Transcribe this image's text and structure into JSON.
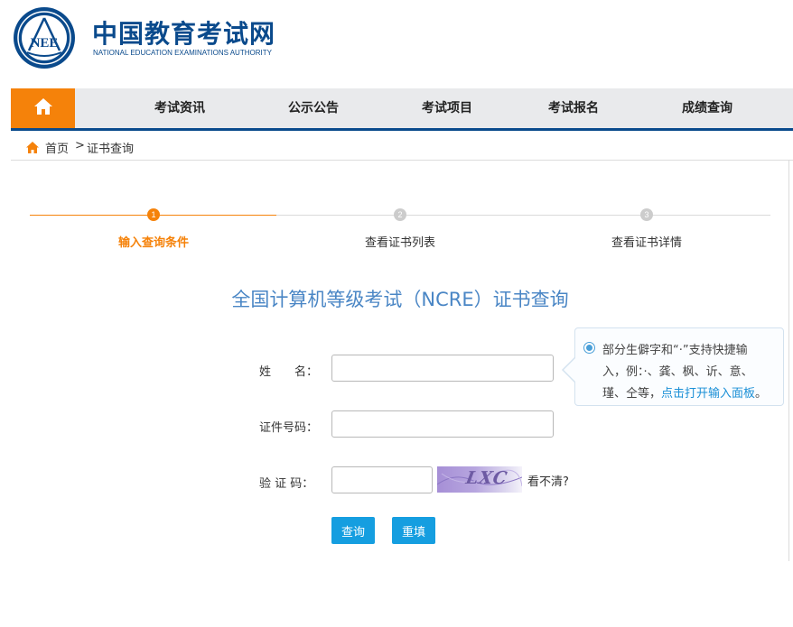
{
  "header": {
    "logo_text": "NEE",
    "site_name": "中国教育考试网",
    "site_name_en": "NATIONAL EDUCATION EXAMINATIONS AUTHORITY"
  },
  "nav": {
    "home_icon": "home-icon",
    "items": [
      "考试资讯",
      "公示公告",
      "考试项目",
      "考试报名",
      "成绩查询"
    ]
  },
  "breadcrumb": {
    "home": "首页",
    "separator": ">",
    "current": "证书查询"
  },
  "steps": [
    {
      "number": "1",
      "label": "输入查询条件",
      "active": true
    },
    {
      "number": "2",
      "label": "查看证书列表",
      "active": false
    },
    {
      "number": "3",
      "label": "查看证书详情",
      "active": false
    }
  ],
  "form": {
    "title": "全国计算机等级考试（NCRE）证书查询",
    "name_label": "姓　　名：",
    "name_value": "",
    "id_label": "证件号码：",
    "id_value": "",
    "captcha_label": "验 证 码：",
    "captcha_value": "",
    "captcha_image_text": "LXC",
    "refresh_text": "看不清?",
    "query_button": "查询",
    "reset_button": "重填"
  },
  "tip": {
    "line1": "部分生僻字和“·”支持快捷输",
    "line2": "入，例：·、龚、枫、䜣、意、",
    "line3_prefix": "瑾、仝等，",
    "line3_link": "点击打开输入面板",
    "line3_suffix": "。"
  },
  "colors": {
    "brand_blue": "#0a4a8c",
    "accent_orange": "#f5820a",
    "button_blue": "#159ee0",
    "title_blue": "#4a86c5",
    "inactive_gray": "#cccccc"
  }
}
